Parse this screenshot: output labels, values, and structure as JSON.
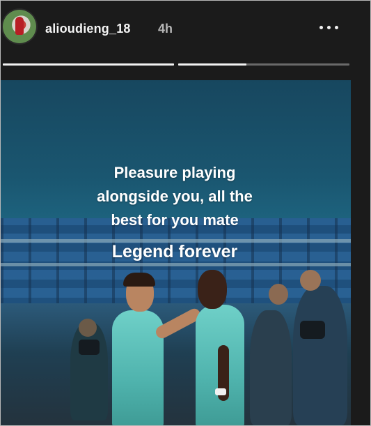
{
  "header": {
    "username": "alioudieng_18",
    "timestamp": "4h",
    "more_icon": "more-horizontal-icon"
  },
  "story": {
    "segments_total": 2,
    "segment_progress": [
      1.0,
      0.4
    ],
    "caption_lines": [
      "Pleasure playing",
      "alongside you, all the",
      "best for you mate"
    ],
    "caption_emphasis": "Legend forever"
  },
  "colors": {
    "background": "#1b1b1b",
    "progress_fill": "#f2f2f2",
    "kit": "#5cc4bc"
  }
}
